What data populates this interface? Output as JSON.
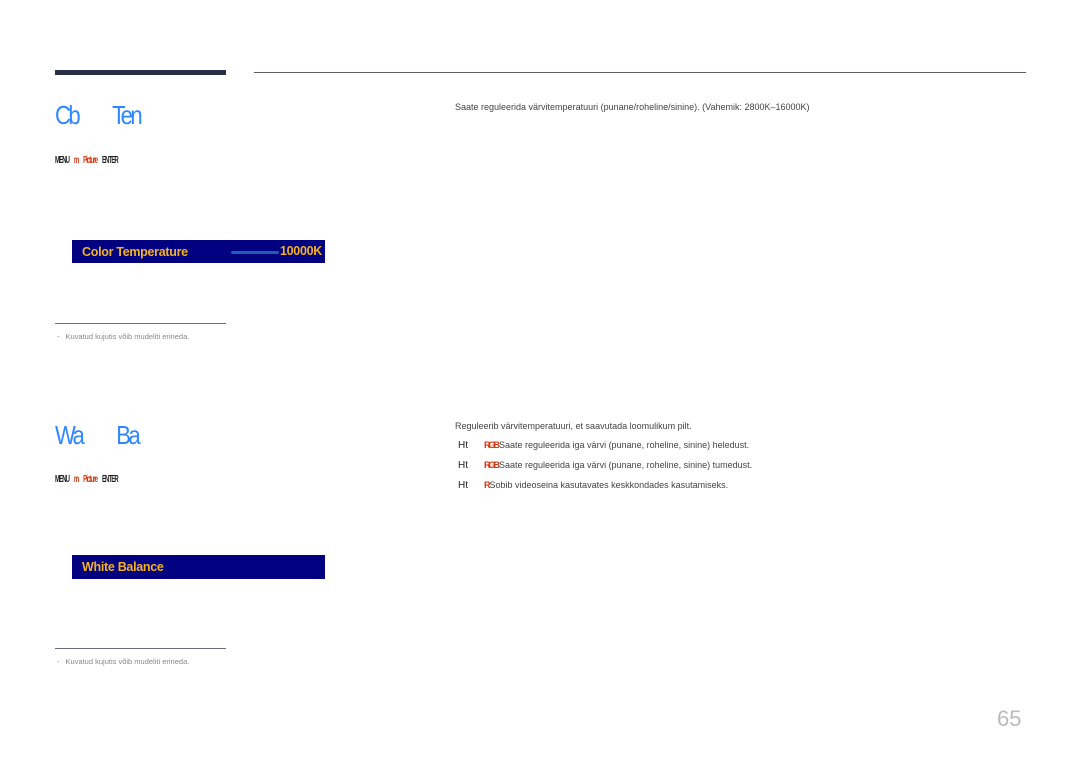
{
  "page_number": "65",
  "sections": [
    {
      "title_parts": [
        "Cb",
        "Ten"
      ],
      "menu_path": {
        "parts": [
          {
            "text": "MENU",
            "style": "blk"
          },
          {
            "text": "m",
            "style": "red"
          },
          {
            "text": "Picture",
            "style": "red"
          },
          {
            "text": "ENTER",
            "style": "blk"
          }
        ]
      },
      "osd": {
        "label": "Color Temperature",
        "value": "10000K"
      },
      "note": {
        "dash": "-",
        "text": "Kuvatud kujutis võib mudeliti erineda."
      },
      "description": "Saate reguleerida värvitemperatuuri (punane/roheline/sinine). (Vahemik: 2800K–16000K)"
    },
    {
      "title_parts": [
        "Wa",
        "Ba"
      ],
      "menu_path": {
        "parts": [
          {
            "text": "MENU",
            "style": "blk"
          },
          {
            "text": "m",
            "style": "red"
          },
          {
            "text": "Picture",
            "style": "red"
          },
          {
            "text": "ENTER",
            "style": "blk"
          }
        ]
      },
      "osd": {
        "label": "White Balance"
      },
      "note": {
        "dash": "-",
        "text": "Kuvatud kujutis võib mudeliti erineda."
      },
      "description": "Reguleerib värvitemperatuuri, et saavutada loomulikum pilt.",
      "bullets": [
        {
          "marker": "Ht",
          "glyph": "RGB",
          "text": "Saate reguleerida iga värvi (punane, roheline, sinine) heledust."
        },
        {
          "marker": "Ht",
          "glyph": "RGB",
          "text": "Saate reguleerida iga värvi (punane, roheline, sinine) tumedust."
        },
        {
          "marker": "Ht",
          "glyph": "R",
          "text": "Sobib videoseina kasutavates keskkondades kasutamiseks."
        }
      ]
    }
  ]
}
